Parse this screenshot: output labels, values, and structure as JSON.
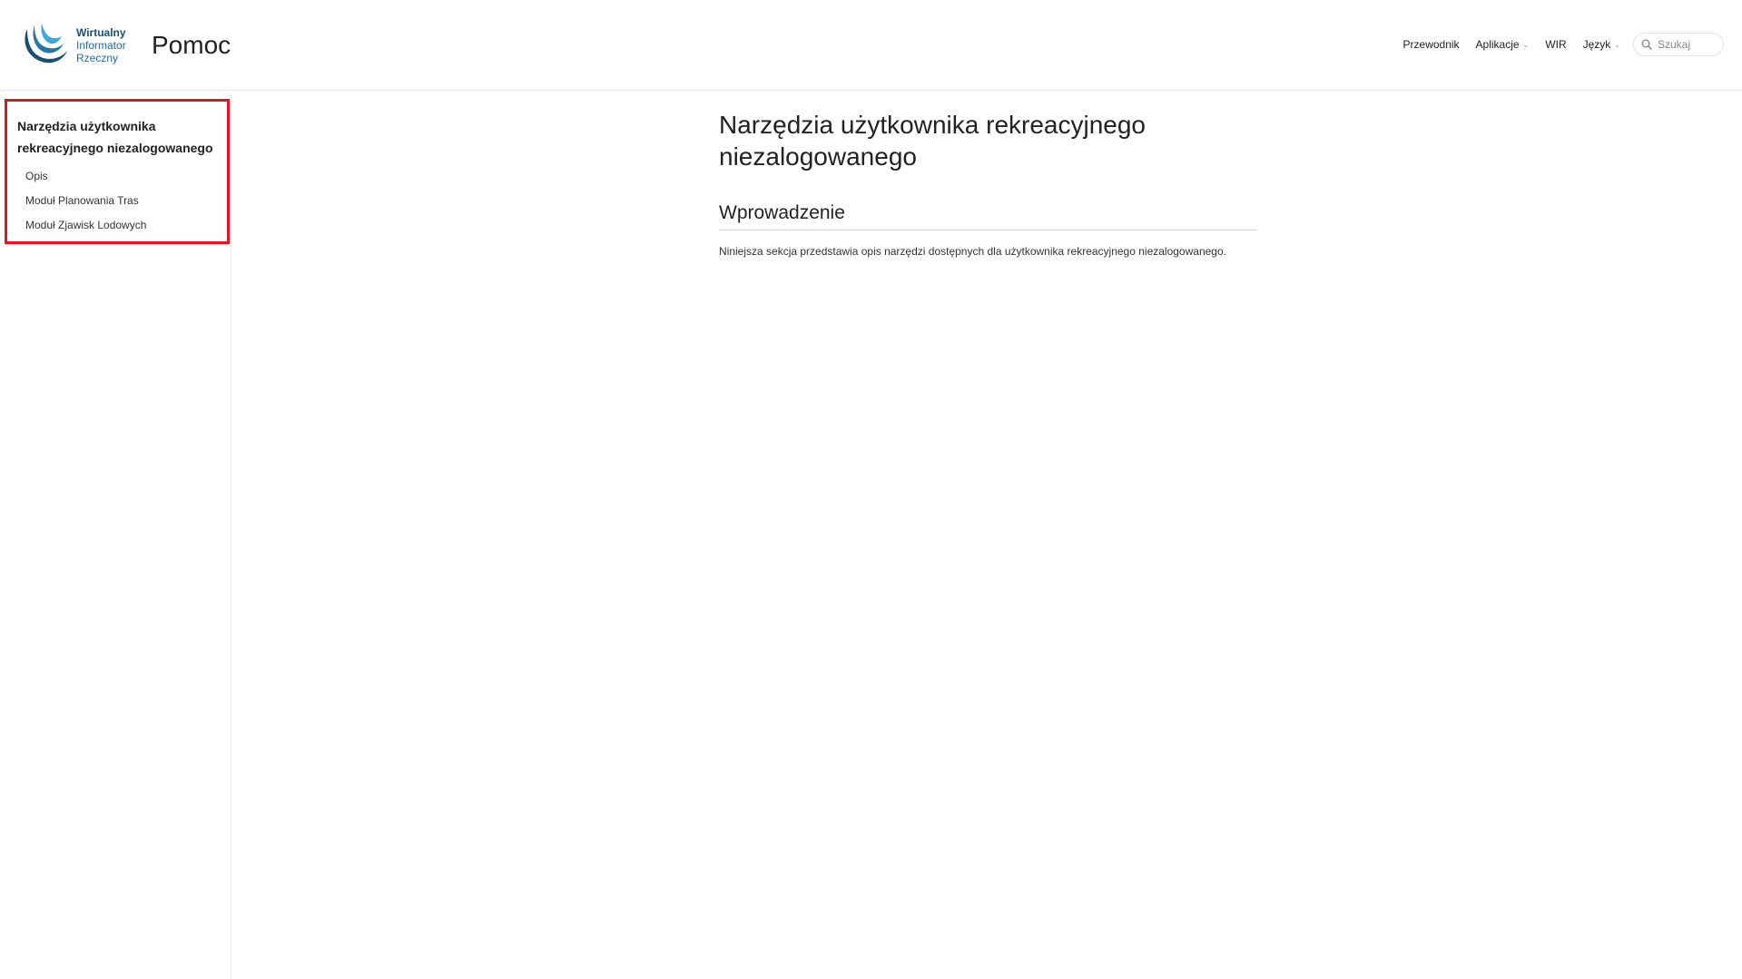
{
  "header": {
    "logo": {
      "line1": "Wirtualny",
      "line2": "Informator",
      "line3": "Rzeczny",
      "icon": "wave-logo-icon"
    },
    "site_title": "Pomoc",
    "nav": {
      "items": [
        {
          "label": "Przewodnik",
          "has_dropdown": false
        },
        {
          "label": "Aplikacje",
          "has_dropdown": true
        },
        {
          "label": "WIR",
          "has_dropdown": false
        },
        {
          "label": "Język",
          "has_dropdown": true
        }
      ],
      "caret": "⌄"
    },
    "search": {
      "placeholder": "Szukaj",
      "icon": "search-icon"
    }
  },
  "sidebar": {
    "section_title": "Narzędzia użytkownika rekreacyjnego niezalogowanego",
    "links": [
      {
        "label": "Opis"
      },
      {
        "label": "Moduł Planowania Tras"
      },
      {
        "label": "Moduł Zjawisk Lodowych"
      }
    ],
    "highlight_color": "#e3161c"
  },
  "main": {
    "title": "Narzędzia użytkownika rekreacyjnego niezalogowanego",
    "section_heading": "Wprowadzenie",
    "intro": "Niniejsza sekcja przedstawia opis narzędzi dostępnych dla użytkownika rekreacyjnego niezalogowanego."
  },
  "colors": {
    "brand_dark": "#1b4f72",
    "brand_light": "#2b8fc4"
  }
}
